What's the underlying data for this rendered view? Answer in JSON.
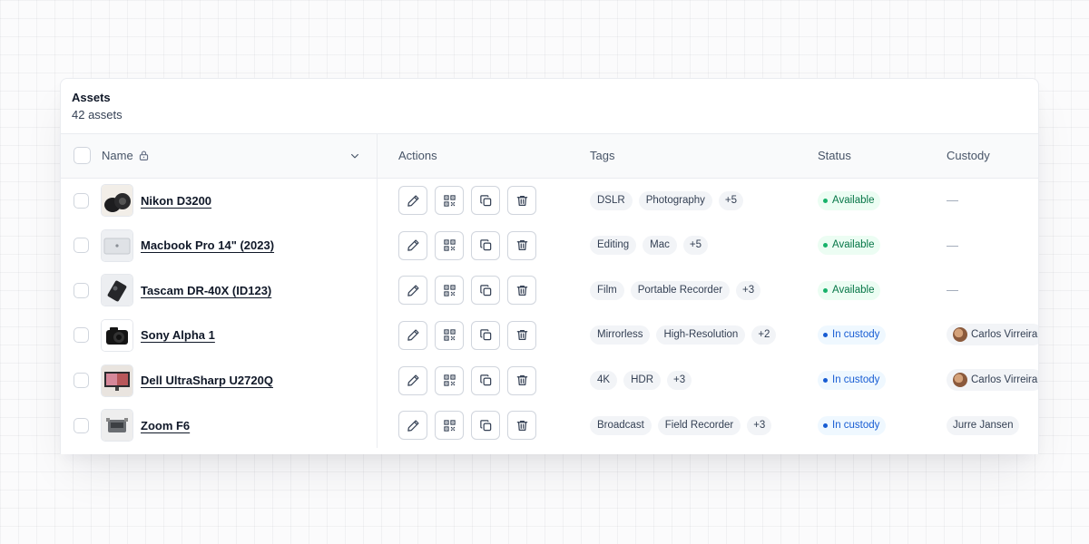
{
  "header": {
    "title": "Assets",
    "count_label": "42 assets"
  },
  "columns": {
    "name": "Name",
    "actions": "Actions",
    "tags": "Tags",
    "status": "Status",
    "custody": "Custody"
  },
  "colors": {
    "available_bg": "#ecfdf3",
    "available_text": "#067647",
    "custody_bg": "#eff8ff",
    "custody_text": "#175cd3"
  },
  "rows": [
    {
      "name": "Nikon D3200",
      "tags": [
        "DSLR",
        "Photography"
      ],
      "more_tags": "+5",
      "status": "Available",
      "custody": "—"
    },
    {
      "name": "Macbook Pro 14\" (2023)",
      "tags": [
        "Editing",
        "Mac"
      ],
      "more_tags": "+5",
      "status": "Available",
      "custody": "—"
    },
    {
      "name": "Tascam DR-40X (ID123)",
      "tags": [
        "Film",
        "Portable Recorder"
      ],
      "more_tags": "+3",
      "status": "Available",
      "custody": "—"
    },
    {
      "name": "Sony Alpha 1",
      "tags": [
        "Mirrorless",
        "High-Resolution"
      ],
      "more_tags": "+2",
      "status": "In custody",
      "custody": "Carlos Virreira"
    },
    {
      "name": "Dell UltraSharp U2720Q",
      "tags": [
        "4K",
        "HDR"
      ],
      "more_tags": "+3",
      "status": "In custody",
      "custody": "Carlos Virreira"
    },
    {
      "name": "Zoom F6",
      "tags": [
        "Broadcast",
        "Field Recorder"
      ],
      "more_tags": "+3",
      "status": "In custody",
      "custody": "Jurre Jansen"
    }
  ]
}
